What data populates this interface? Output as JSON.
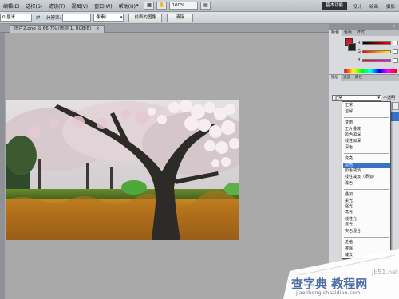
{
  "menubar": {
    "items": [
      {
        "label": "编辑(E)"
      },
      {
        "label": "选择(S)"
      },
      {
        "label": "滤镜(T)"
      },
      {
        "label": "视图(V)"
      },
      {
        "label": "窗口(W)"
      },
      {
        "label": "帮助(H)"
      }
    ],
    "zoom": "100%",
    "workspaces": [
      {
        "label": "基本功能",
        "active": true
      },
      {
        "label": "设计"
      },
      {
        "label": "绘画"
      },
      {
        "label": "摄影"
      }
    ]
  },
  "options": {
    "width_value": "0 厘米",
    "resolution_label": "分辨率:",
    "resolution_value": "",
    "unit_select": "像素/...",
    "front_image_button": "前面的图像",
    "clear_button": "清除"
  },
  "document": {
    "tab_title": "图片2.png @ 66.7% (图层 1, RGB/8)",
    "tab_close": "×"
  },
  "color_panel": {
    "tabs": [
      "颜色",
      "色板",
      "样式"
    ],
    "channels": [
      "R",
      "G",
      "B"
    ]
  },
  "layers_panel": {
    "tabs": [
      "图层",
      "通道",
      "路径"
    ],
    "blend_mode": "正常",
    "opacity_label": "不透明"
  },
  "blend_modes": [
    [
      "正常",
      "溶解"
    ],
    [
      "变暗",
      "正片叠底",
      "颜色加深",
      "线性加深",
      "深色"
    ],
    [
      "变亮",
      "滤色",
      "颜色减淡",
      "线性减淡（添加）",
      "浅色"
    ],
    [
      "叠加",
      "柔光",
      "强光",
      "亮光",
      "线性光",
      "点光",
      "实色混合"
    ],
    [
      "差值",
      "排除",
      "减去"
    ]
  ],
  "selected_blend_mode": "滤色",
  "watermark": {
    "site": "jb51.net",
    "cn": "查字典 教程网",
    "url": "jiaocheng.chazidian.com"
  }
}
